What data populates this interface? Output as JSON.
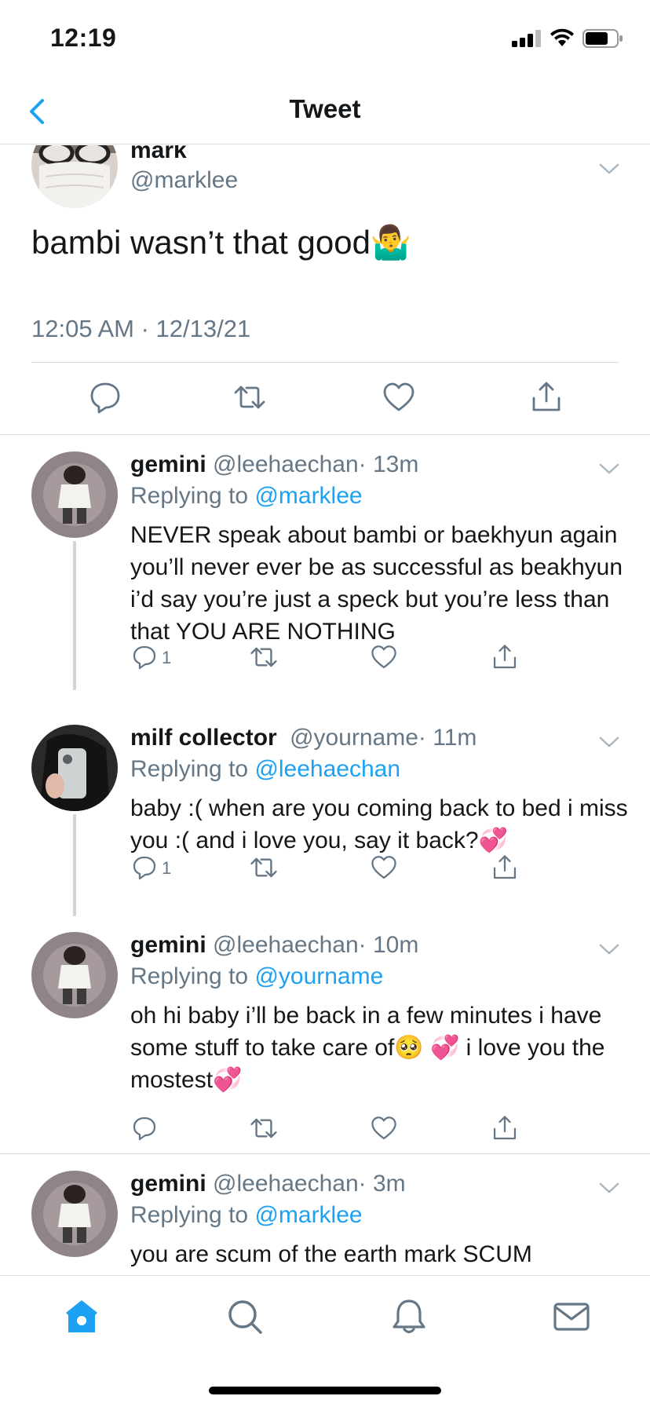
{
  "status_bar": {
    "time": "12:19"
  },
  "nav": {
    "title": "Tweet"
  },
  "main_tweet": {
    "name": "mark",
    "handle": "@marklee",
    "text": "bambi wasn’t that good🤷‍♂️",
    "timestamp": "12:05 AM · 12/13/21"
  },
  "replies": [
    {
      "name": "gemini",
      "handle": "@leehaechan",
      "time": "· 13m",
      "replying_label": "Replying to",
      "replying_to": "@marklee",
      "text": "NEVER speak about bambi or baekhyun again you’ll never ever be as successful as beakhyun i’d say you’re just a speck but you’re less than that YOU ARE NOTHING",
      "reply_count": "1"
    },
    {
      "name": "milf collector",
      "handle": "@yourname",
      "time": "· 11m",
      "replying_label": "Replying to",
      "replying_to": "@leehaechan",
      "text": "baby :( when are you coming back to bed i miss you :( and i love you, say it back?💞",
      "reply_count": "1"
    },
    {
      "name": "gemini",
      "handle": "@leehaechan",
      "time": "· 10m",
      "replying_label": "Replying to",
      "replying_to": "@yourname",
      "text": "oh hi baby i’ll be back in a few minutes i have some stuff to take care of🥺 💞 i love you the mostest💞",
      "reply_count": ""
    },
    {
      "name": "gemini",
      "handle": "@leehaechan",
      "time": "· 3m",
      "replying_label": "Replying to",
      "replying_to": "@marklee",
      "text": "you are scum of the earth mark SCUM",
      "reply_count": ""
    }
  ],
  "tabs": [
    "home-icon",
    "search-icon",
    "notifications-icon",
    "messages-icon"
  ],
  "colors": {
    "accent": "#1da1f2",
    "secondary_text": "#657786",
    "divider": "#d8dde1"
  }
}
